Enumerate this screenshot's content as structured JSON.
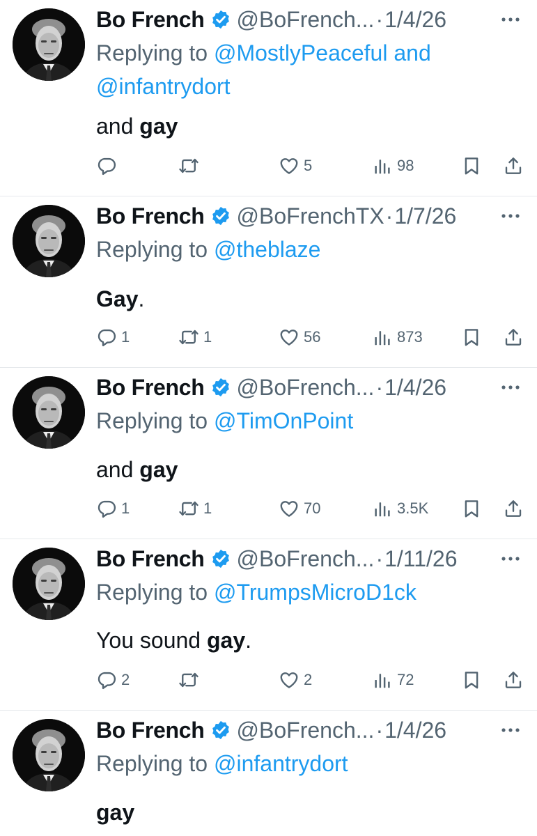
{
  "colors": {
    "accent": "#1d9bf0",
    "muted": "#536471",
    "text": "#0f1419",
    "divider": "#e6e9ec"
  },
  "tweets": [
    {
      "name": "Bo French",
      "handle": "@BoFrench...",
      "date": "1/4/26",
      "reply_prefix": "Replying to ",
      "mentions": [
        "@MostlyPeaceful",
        "@infantrydort"
      ],
      "mention_joiner": " and ",
      "text_parts": [
        {
          "t": "and ",
          "b": false
        },
        {
          "t": "gay",
          "b": true
        }
      ],
      "counts": {
        "replies": "",
        "retweets": "",
        "likes": "5",
        "views": "98"
      }
    },
    {
      "name": "Bo French",
      "handle": "@BoFrenchTX",
      "date": "1/7/26",
      "reply_prefix": "Replying to ",
      "mentions": [
        "@theblaze"
      ],
      "mention_joiner": "",
      "text_parts": [
        {
          "t": "Gay",
          "b": true
        },
        {
          "t": ".",
          "b": false
        }
      ],
      "counts": {
        "replies": "1",
        "retweets": "1",
        "likes": "56",
        "views": "873"
      }
    },
    {
      "name": "Bo French",
      "handle": "@BoFrench...",
      "date": "1/4/26",
      "reply_prefix": "Replying to ",
      "mentions": [
        "@TimOnPoint"
      ],
      "mention_joiner": "",
      "text_parts": [
        {
          "t": "and ",
          "b": false
        },
        {
          "t": "gay",
          "b": true
        }
      ],
      "counts": {
        "replies": "1",
        "retweets": "1",
        "likes": "70",
        "views": "3.5K"
      }
    },
    {
      "name": "Bo French",
      "handle": "@BoFrench...",
      "date": "1/11/26",
      "reply_prefix": "Replying to ",
      "mentions": [
        "@TrumpsMicroD1ck"
      ],
      "mention_joiner": "",
      "text_parts": [
        {
          "t": "You sound ",
          "b": false
        },
        {
          "t": "gay",
          "b": true
        },
        {
          "t": ".",
          "b": false
        }
      ],
      "counts": {
        "replies": "2",
        "retweets": "",
        "likes": "2",
        "views": "72"
      }
    },
    {
      "name": "Bo French",
      "handle": "@BoFrench...",
      "date": "1/4/26",
      "reply_prefix": "Replying to ",
      "mentions": [
        "@infantrydort"
      ],
      "mention_joiner": "",
      "text_parts": [
        {
          "t": "gay",
          "b": true
        }
      ],
      "counts": null
    }
  ],
  "icons": {
    "verified": "verified-badge-icon",
    "more": "more-options-icon",
    "reply": "reply-icon",
    "retweet": "retweet-icon",
    "like": "heart-icon",
    "views": "views-icon",
    "bookmark": "bookmark-icon",
    "share": "share-icon"
  }
}
